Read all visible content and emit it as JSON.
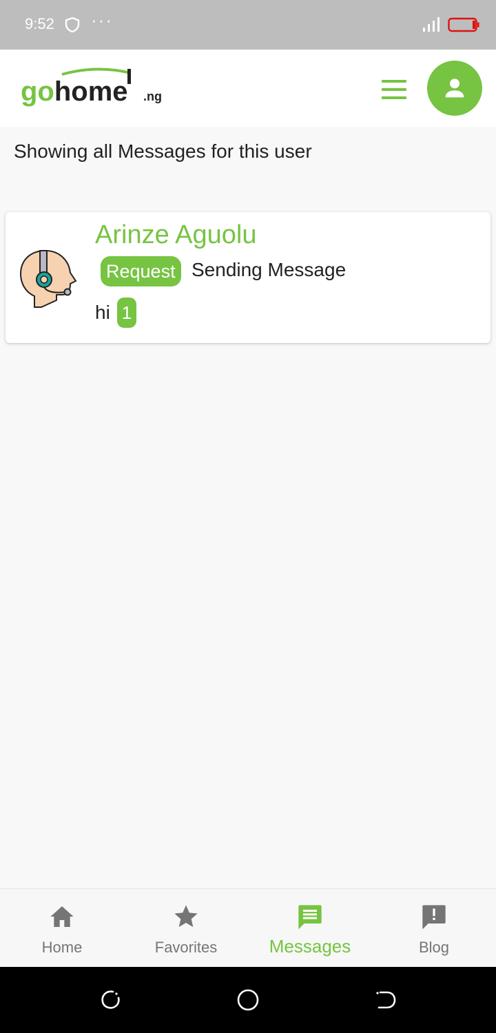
{
  "status_bar": {
    "time": "9:52",
    "dots": "···",
    "icons": [
      "shield-icon",
      "signal-icon",
      "battery-icon"
    ]
  },
  "header": {
    "logo_text": "gohome",
    "logo_suffix": ".ng",
    "icons": [
      "menu-icon",
      "user-icon"
    ]
  },
  "page": {
    "heading": "Showing all Messages for this user"
  },
  "messages": [
    {
      "sender": "Arinze Aguolu",
      "tag": "Request",
      "status": "Sending Message",
      "preview": "hi",
      "unread_count": "1",
      "avatar_icon": "support-agent-icon"
    }
  ],
  "bottom_nav": {
    "items": [
      {
        "label": "Home",
        "icon": "home-icon",
        "active": false
      },
      {
        "label": "Favorites",
        "icon": "star-icon",
        "active": false
      },
      {
        "label": "Messages",
        "icon": "chat-icon",
        "active": true
      },
      {
        "label": "Blog",
        "icon": "feedback-icon",
        "active": false
      }
    ]
  },
  "colors": {
    "accent": "#76c442",
    "status_bar": "#bdbdbd",
    "inactive_nav": "#757575",
    "battery_low": "#e01010"
  }
}
